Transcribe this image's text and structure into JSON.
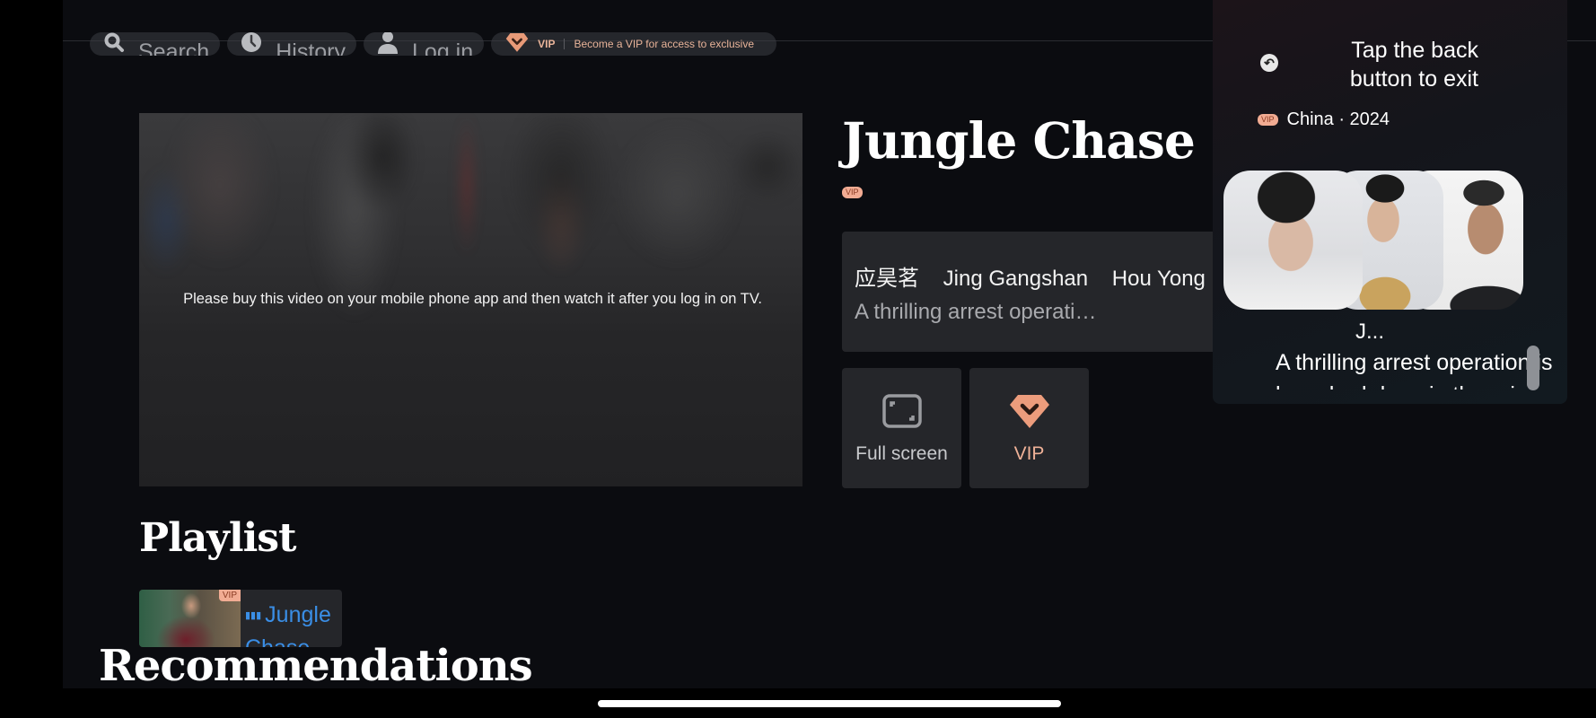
{
  "topnav": {
    "search_label": "Search",
    "history_label": "History",
    "login_label": "Log in",
    "vip_label": "VIP",
    "vip_message": "Become a VIP for access to exclusive"
  },
  "player": {
    "message": "Please buy this video on your mobile phone app and then watch it after you log in on TV."
  },
  "details": {
    "title": "Jungle Chase",
    "vip_badge": "VIP",
    "cast": [
      "应昊茗",
      "Jing Gangshan",
      "Hou Yong"
    ],
    "description": "A thrilling arrest operati…"
  },
  "actions": {
    "fullscreen_label": "Full screen",
    "vip_label": "VIP"
  },
  "playlist": {
    "heading": "Playlist",
    "items": [
      {
        "title": "Jungle Chase",
        "badge": "VIP",
        "playing": true
      }
    ]
  },
  "recommendations": {
    "heading": "Recommendations"
  },
  "overlay": {
    "hint": "Tap the back button to exit",
    "vip_badge": "VIP",
    "meta": "China · 2024",
    "name": "J...",
    "description": "A thrilling arrest operation is",
    "description_line2": "launched deep in the rainforest"
  },
  "colors": {
    "background": "#0b0c10",
    "card": "#25262a",
    "vip_accent": "#efb197",
    "playing_blue": "#3a8ee6"
  }
}
